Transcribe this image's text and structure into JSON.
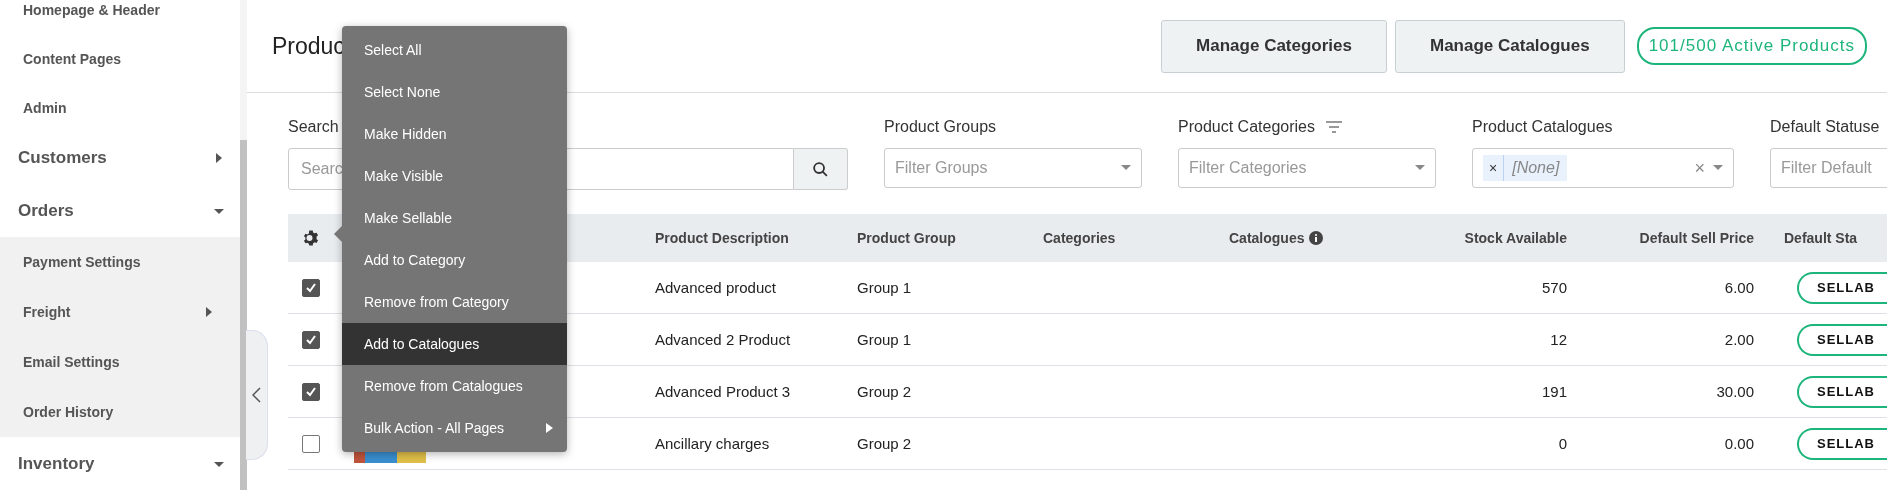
{
  "sidebar": {
    "items": [
      {
        "kind": "link",
        "label": "Homepage & Header"
      },
      {
        "kind": "link",
        "label": "Content Pages"
      },
      {
        "kind": "link",
        "label": "Admin"
      },
      {
        "kind": "section",
        "label": "Customers",
        "expanded": false
      },
      {
        "kind": "section",
        "label": "Orders",
        "expanded": true,
        "children": [
          {
            "kind": "link",
            "label": "Payment Settings"
          },
          {
            "kind": "link",
            "label": "Freight",
            "expanded": false
          },
          {
            "kind": "link",
            "label": "Email Settings"
          },
          {
            "kind": "link",
            "label": "Order History"
          }
        ]
      },
      {
        "kind": "section",
        "label": "Inventory",
        "expanded": true
      }
    ]
  },
  "header": {
    "title": "Produc",
    "buttons": [
      "Manage Categories",
      "Manage Catalogues"
    ],
    "badge": "101/500 Active Products"
  },
  "filters": [
    {
      "kind": "search",
      "label": "Search",
      "placeholder": "Searc"
    },
    {
      "kind": "select",
      "label": "Product Groups",
      "placeholder": "Filter Groups"
    },
    {
      "kind": "select",
      "label": "Product Categories",
      "placeholder": "Filter Categories",
      "filter_icon": true
    },
    {
      "kind": "tags",
      "label": "Product Catalogues",
      "tags": [
        {
          "remove": "×",
          "label": "[None]"
        }
      ],
      "clear": "×"
    },
    {
      "kind": "select",
      "label": "Default Statuse",
      "placeholder": "Filter Default"
    }
  ],
  "table": {
    "columns": [
      {
        "label": "Product Description",
        "kind": "text"
      },
      {
        "label": "Product Group",
        "kind": "text"
      },
      {
        "label": "Categories",
        "kind": "text"
      },
      {
        "label": "Catalogues",
        "kind": "text",
        "info": true
      },
      {
        "label": "Stock Available",
        "kind": "number"
      },
      {
        "label": "Default Sell Price",
        "kind": "number"
      },
      {
        "label": "Default Sta",
        "kind": "text"
      }
    ],
    "rows": [
      {
        "checked": true,
        "photo": false,
        "cells": [
          "Advanced product",
          "Group 1",
          "",
          "",
          "570",
          "6.00"
        ],
        "status": "SELLAB"
      },
      {
        "checked": true,
        "photo": false,
        "cells": [
          "Advanced 2 Product",
          "Group 1",
          "",
          "",
          "12",
          "2.00"
        ],
        "status": "SELLAB"
      },
      {
        "checked": true,
        "photo": false,
        "cells": [
          "Advanced Product 3",
          "Group 2",
          "",
          "",
          "191",
          "30.00"
        ],
        "status": "SELLAB"
      },
      {
        "checked": false,
        "photo": true,
        "cells": [
          "Ancillary charges",
          "Group 2",
          "",
          "",
          "0",
          "0.00"
        ],
        "status": "SELLAB"
      }
    ]
  },
  "menu": {
    "items": [
      {
        "label": "Select All",
        "selected": false,
        "kind": "action"
      },
      {
        "label": "Select None",
        "selected": false,
        "kind": "action"
      },
      {
        "label": "Make Hidden",
        "selected": false,
        "kind": "action"
      },
      {
        "label": "Make Visible",
        "selected": false,
        "kind": "action"
      },
      {
        "label": "Make Sellable",
        "selected": false,
        "kind": "action"
      },
      {
        "label": "Add to Category",
        "selected": false,
        "kind": "action"
      },
      {
        "label": "Remove from Category",
        "selected": false,
        "kind": "action"
      },
      {
        "label": "Add to Catalogues",
        "selected": true,
        "kind": "action"
      },
      {
        "label": "Remove from Catalogues",
        "selected": false,
        "kind": "action"
      },
      {
        "label": "Bulk Action - All Pages",
        "selected": false,
        "kind": "submenu"
      }
    ]
  }
}
